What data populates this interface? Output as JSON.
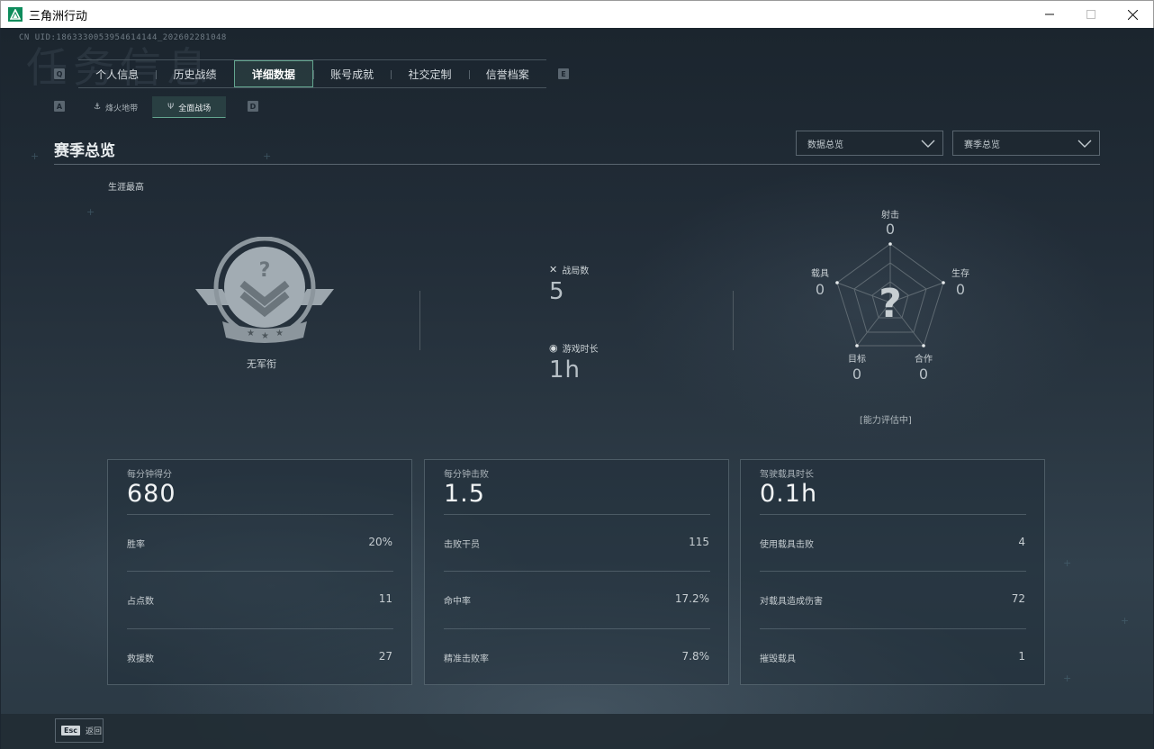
{
  "window": {
    "title": "三角洲行动",
    "icon": "delta-force-app-icon",
    "minimize": "—",
    "maximize": "☐",
    "close": "✕"
  },
  "header": {
    "uid": "CN UID:1863330053954614144_202602281048",
    "bg_text": "任务信息"
  },
  "tabs": {
    "left_key": "Q",
    "right_key": "E",
    "items": [
      {
        "label": "个人信息"
      },
      {
        "label": "历史战绩"
      },
      {
        "label": "详细数据"
      },
      {
        "label": "账号成就"
      },
      {
        "label": "社交定制"
      },
      {
        "label": "信誉档案"
      }
    ]
  },
  "subtabs": {
    "left_key": "A",
    "right_key": "D",
    "items": [
      {
        "label": "烽火地带"
      },
      {
        "label": "全面战场"
      }
    ]
  },
  "section": {
    "title": "赛季总览",
    "select1": "数据总览",
    "select2": "赛季总览"
  },
  "overview": {
    "career_high": "生涯最高",
    "rank": "无军衔",
    "matches_label": "战局数",
    "matches_value": "5",
    "playtime_label": "游戏时长",
    "playtime_value": "1h"
  },
  "radar": {
    "shooting_label": "射击",
    "shooting_value": "0",
    "survival_label": "生存",
    "survival_value": "0",
    "coop_label": "合作",
    "coop_value": "0",
    "target_label": "目标",
    "target_value": "0",
    "vehicle_label": "载具",
    "vehicle_value": "0",
    "center_mark": "?",
    "status": "[能力评估中]"
  },
  "cards": [
    {
      "label": "每分钟得分",
      "value": "680",
      "rows": [
        {
          "label": "胜率",
          "value": "20%"
        },
        {
          "label": "占点数",
          "value": "11"
        },
        {
          "label": "救援数",
          "value": "27"
        }
      ]
    },
    {
      "label": "每分钟击败",
      "value": "1.5",
      "rows": [
        {
          "label": "击败干员",
          "value": "115"
        },
        {
          "label": "命中率",
          "value": "17.2%"
        },
        {
          "label": "精准击败率",
          "value": "7.8%"
        }
      ]
    },
    {
      "label": "驾驶载具时长",
      "value": "0.1h",
      "rows": [
        {
          "label": "使用载具击败",
          "value": "4"
        },
        {
          "label": "对载具造成伤害",
          "value": "72"
        },
        {
          "label": "摧毁载具",
          "value": "1"
        }
      ]
    }
  ],
  "footer": {
    "esc_key": "Esc",
    "back_label": "返回"
  }
}
